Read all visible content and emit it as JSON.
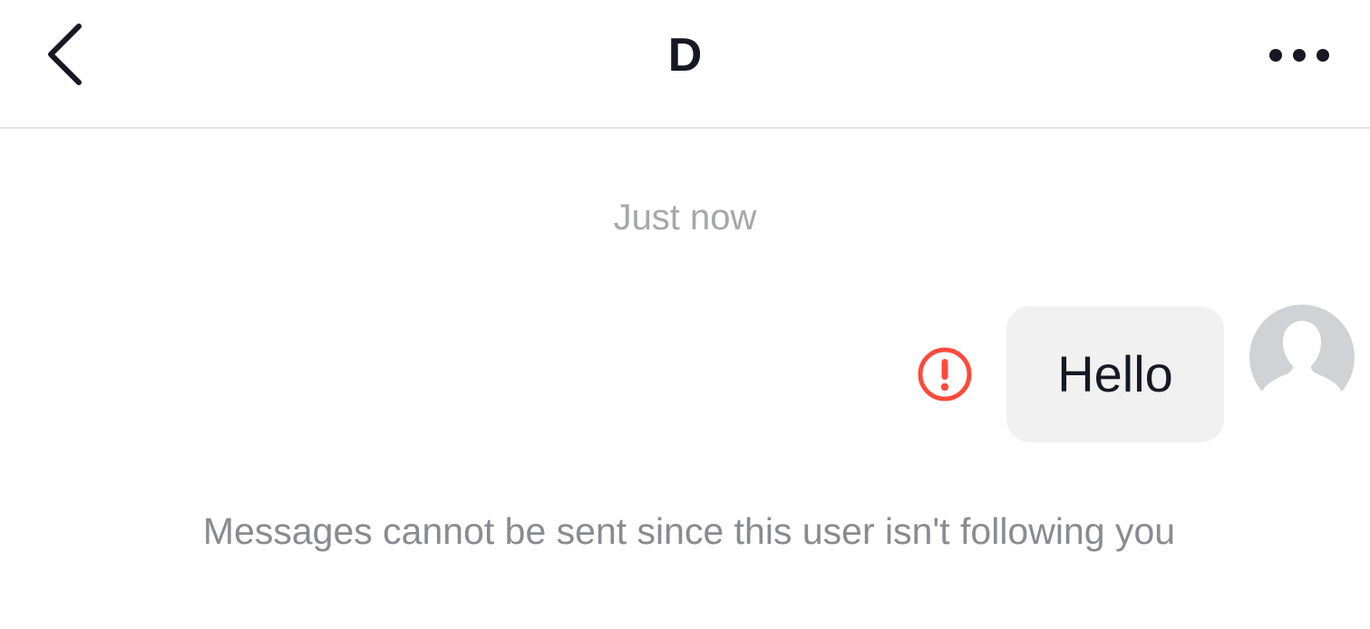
{
  "header": {
    "title": "D",
    "back_icon": "chevron-left-icon",
    "more_icon": "ellipsis-horizontal-icon"
  },
  "conversation": {
    "timestamp": "Just now",
    "messages": [
      {
        "text": "Hello",
        "from_self": true,
        "status": "failed",
        "status_icon": "error-exclamation-icon"
      }
    ],
    "notice": "Messages cannot be sent since this user isn't following you"
  },
  "colors": {
    "text_primary": "#161823",
    "text_timestamp": "#a6a7ab",
    "text_notice": "#8a8b91",
    "bubble_bg": "#f1f1f2",
    "error_red": "#fe2c55",
    "avatar_placeholder": "#d0d2d6",
    "divider": "#e3e3e5"
  }
}
